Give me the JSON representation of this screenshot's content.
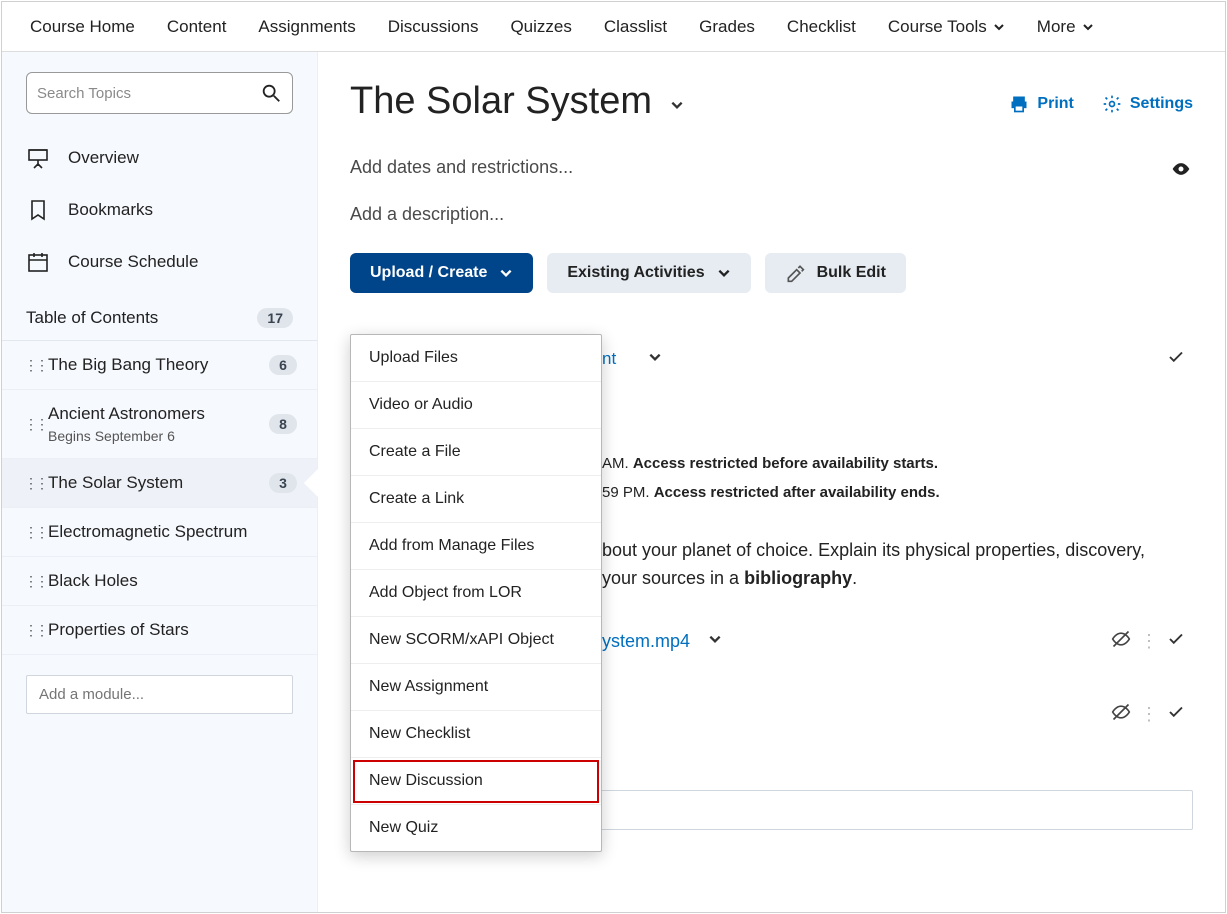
{
  "nav": {
    "items": [
      "Course Home",
      "Content",
      "Assignments",
      "Discussions",
      "Quizzes",
      "Classlist",
      "Grades",
      "Checklist",
      "Course Tools",
      "More"
    ]
  },
  "sidebar": {
    "search_placeholder": "Search Topics",
    "overview": "Overview",
    "bookmarks": "Bookmarks",
    "schedule": "Course Schedule",
    "toc_label": "Table of Contents",
    "toc_count": "17",
    "items": [
      {
        "label": "The Big Bang Theory",
        "count": "6"
      },
      {
        "label": "Ancient Astronomers",
        "sub": "Begins September 6",
        "count": "8"
      },
      {
        "label": "The Solar System",
        "count": "3"
      },
      {
        "label": "Electromagnetic Spectrum"
      },
      {
        "label": "Black Holes"
      },
      {
        "label": "Properties of Stars"
      }
    ],
    "add_module_placeholder": "Add a module..."
  },
  "main": {
    "title": "The Solar System",
    "print": "Print",
    "settings": "Settings",
    "dates_hint": "Add dates and restrictions...",
    "desc_hint": "Add a description...",
    "buttons": {
      "upload": "Upload / Create",
      "existing": "Existing Activities",
      "bulk": "Bulk Edit"
    },
    "dropdown": [
      "Upload Files",
      "Video or Audio",
      "Create a File",
      "Create a Link",
      "Add from Manage Files",
      "Add Object from LOR",
      "New SCORM/xAPI Object",
      "New Assignment",
      "New Checklist",
      "New Discussion",
      "New Quiz"
    ],
    "content": {
      "first_tail": "nt",
      "restrict1_a": "AM.",
      "restrict1_b": "Access restricted before availability starts.",
      "restrict2_a": "59 PM.",
      "restrict2_b": "Access restricted after availability ends.",
      "desc_a": "bout your planet of choice. Explain its physical properties, discovery,",
      "desc_b": "your sources in a ",
      "desc_strong": "bibliography",
      "desc_dot": ".",
      "file_tail": "ystem.mp4"
    }
  }
}
